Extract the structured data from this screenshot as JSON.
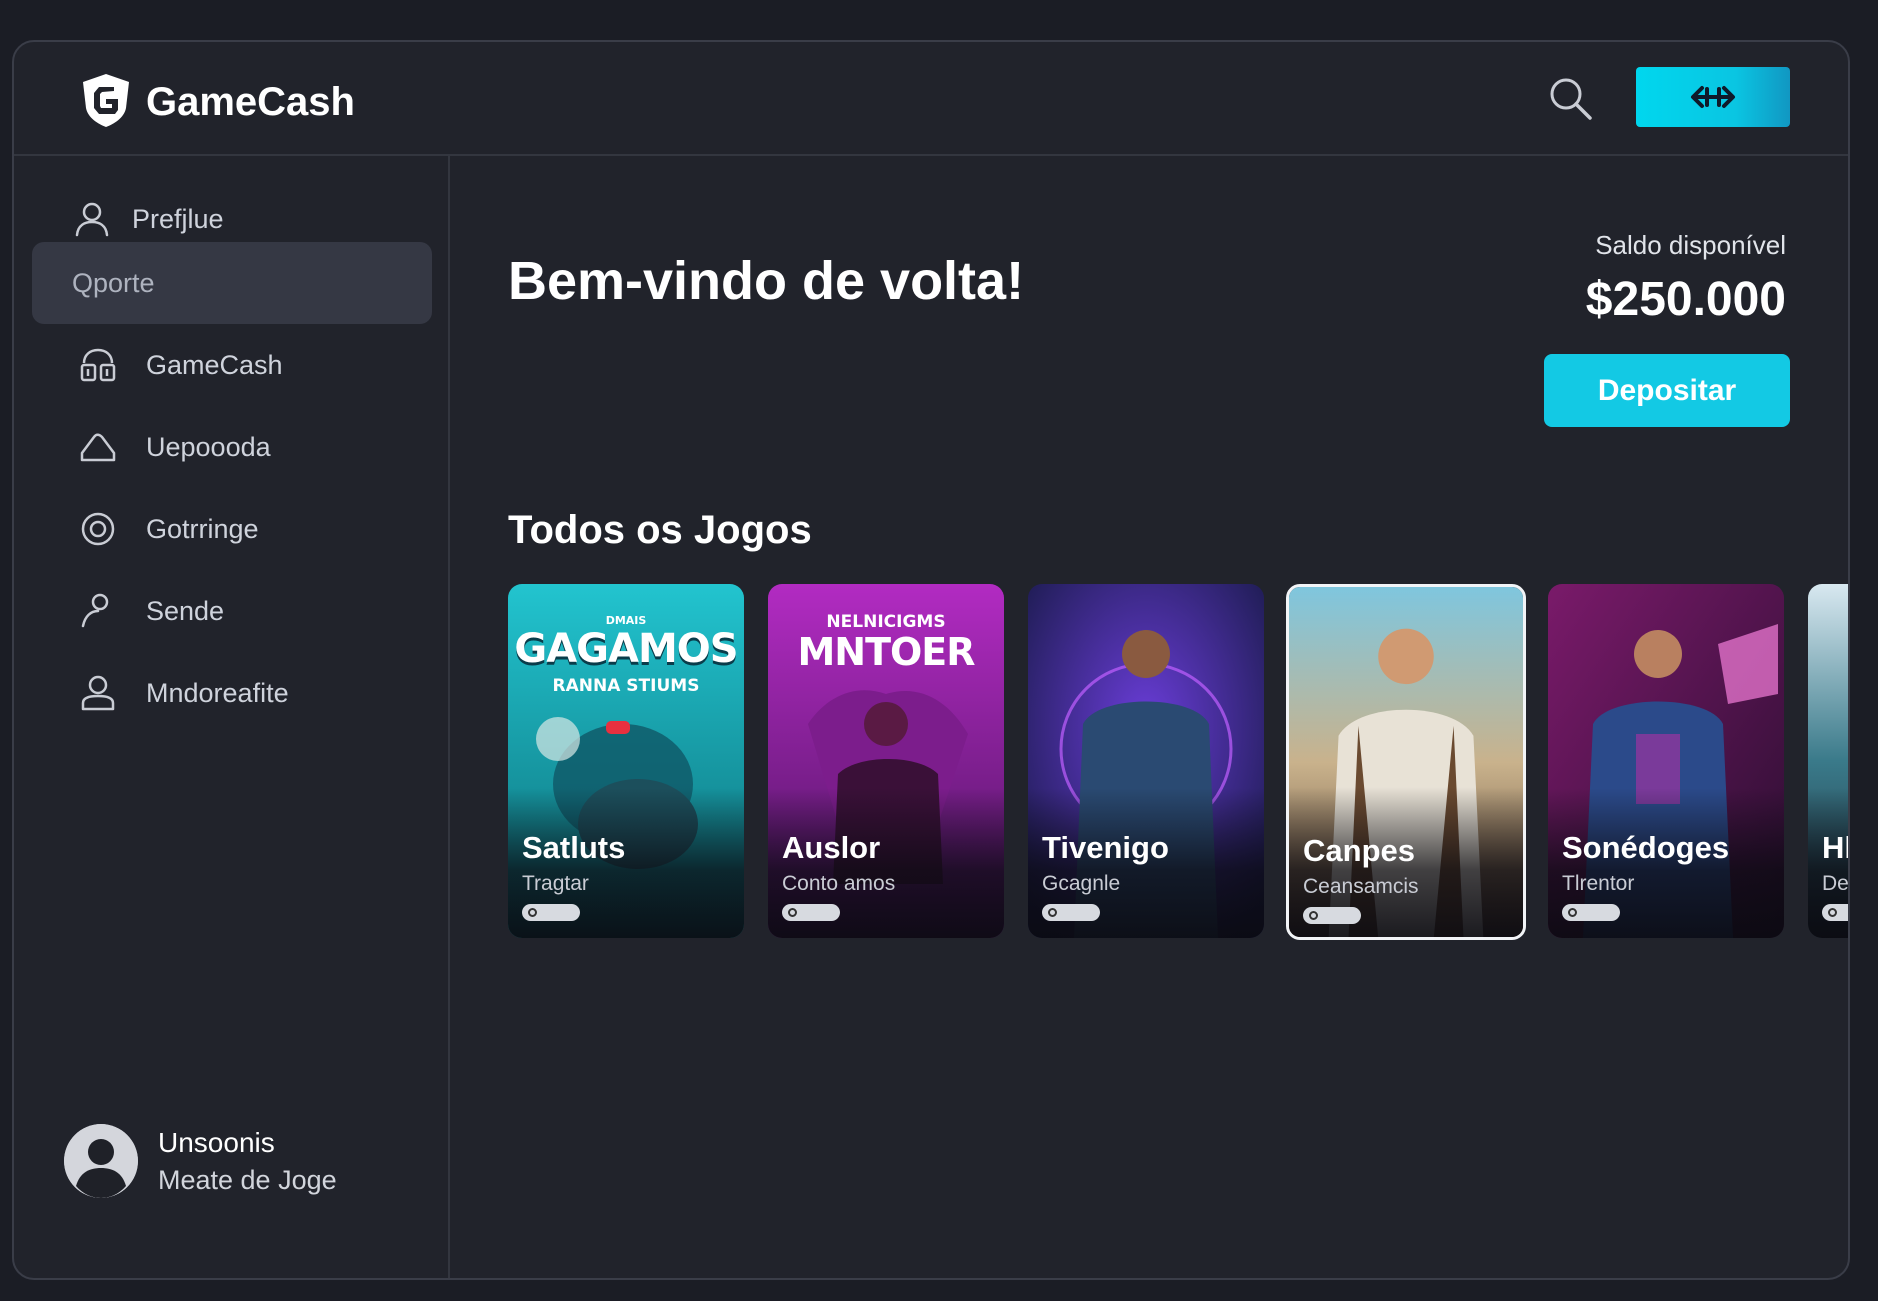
{
  "brand": {
    "name": "GameCash",
    "accent": "#13c9e4"
  },
  "header": {
    "search_icon": "search-icon",
    "action_icon": "double-arrow-icon"
  },
  "sidebar": {
    "items": [
      {
        "label": "Prefjlue",
        "icon": "user-icon",
        "active": false
      },
      {
        "label": "Qporte",
        "icon": "",
        "active": true
      },
      {
        "label": "GameCash",
        "icon": "gamepad-icon",
        "active": false
      },
      {
        "label": "Uepoooda",
        "icon": "cloud-icon",
        "active": false
      },
      {
        "label": "Gotrringe",
        "icon": "target-icon",
        "active": false
      },
      {
        "label": "Sende",
        "icon": "person-icon",
        "active": false
      },
      {
        "label": "Mndoreafite",
        "icon": "account-icon",
        "active": false
      }
    ],
    "user": {
      "name": "Unsoonis",
      "subtitle": "Meate de Joge"
    }
  },
  "main": {
    "welcome": "Bem-vindo de volta!",
    "balance_label": "Saldo disponível",
    "balance_value": "$250.000",
    "deposit_label": "Depositar",
    "section_title": "Todos os Jogos",
    "games": [
      {
        "title": "Satluts",
        "subtitle": "Tragtar",
        "poster_top": "GAGAMOS",
        "poster_sub": "RANNA STIUMS",
        "poster_small": "DMAIS"
      },
      {
        "title": "Auslor",
        "subtitle": "Conto amos",
        "poster_top": "MNTOER",
        "poster_sub": "",
        "poster_small": "NELNICIGMS"
      },
      {
        "title": "Tivenigo",
        "subtitle": "Gcagnle",
        "poster_top": "",
        "poster_sub": "",
        "poster_small": ""
      },
      {
        "title": "Canpes",
        "subtitle": "Ceansamcis",
        "poster_top": "",
        "poster_sub": "",
        "poster_small": ""
      },
      {
        "title": "Sonédoges",
        "subtitle": "Tlrentor",
        "poster_top": "",
        "poster_sub": "",
        "poster_small": ""
      },
      {
        "title": "Hl",
        "subtitle": "De",
        "poster_top": "",
        "poster_sub": "",
        "poster_small": ""
      }
    ]
  }
}
